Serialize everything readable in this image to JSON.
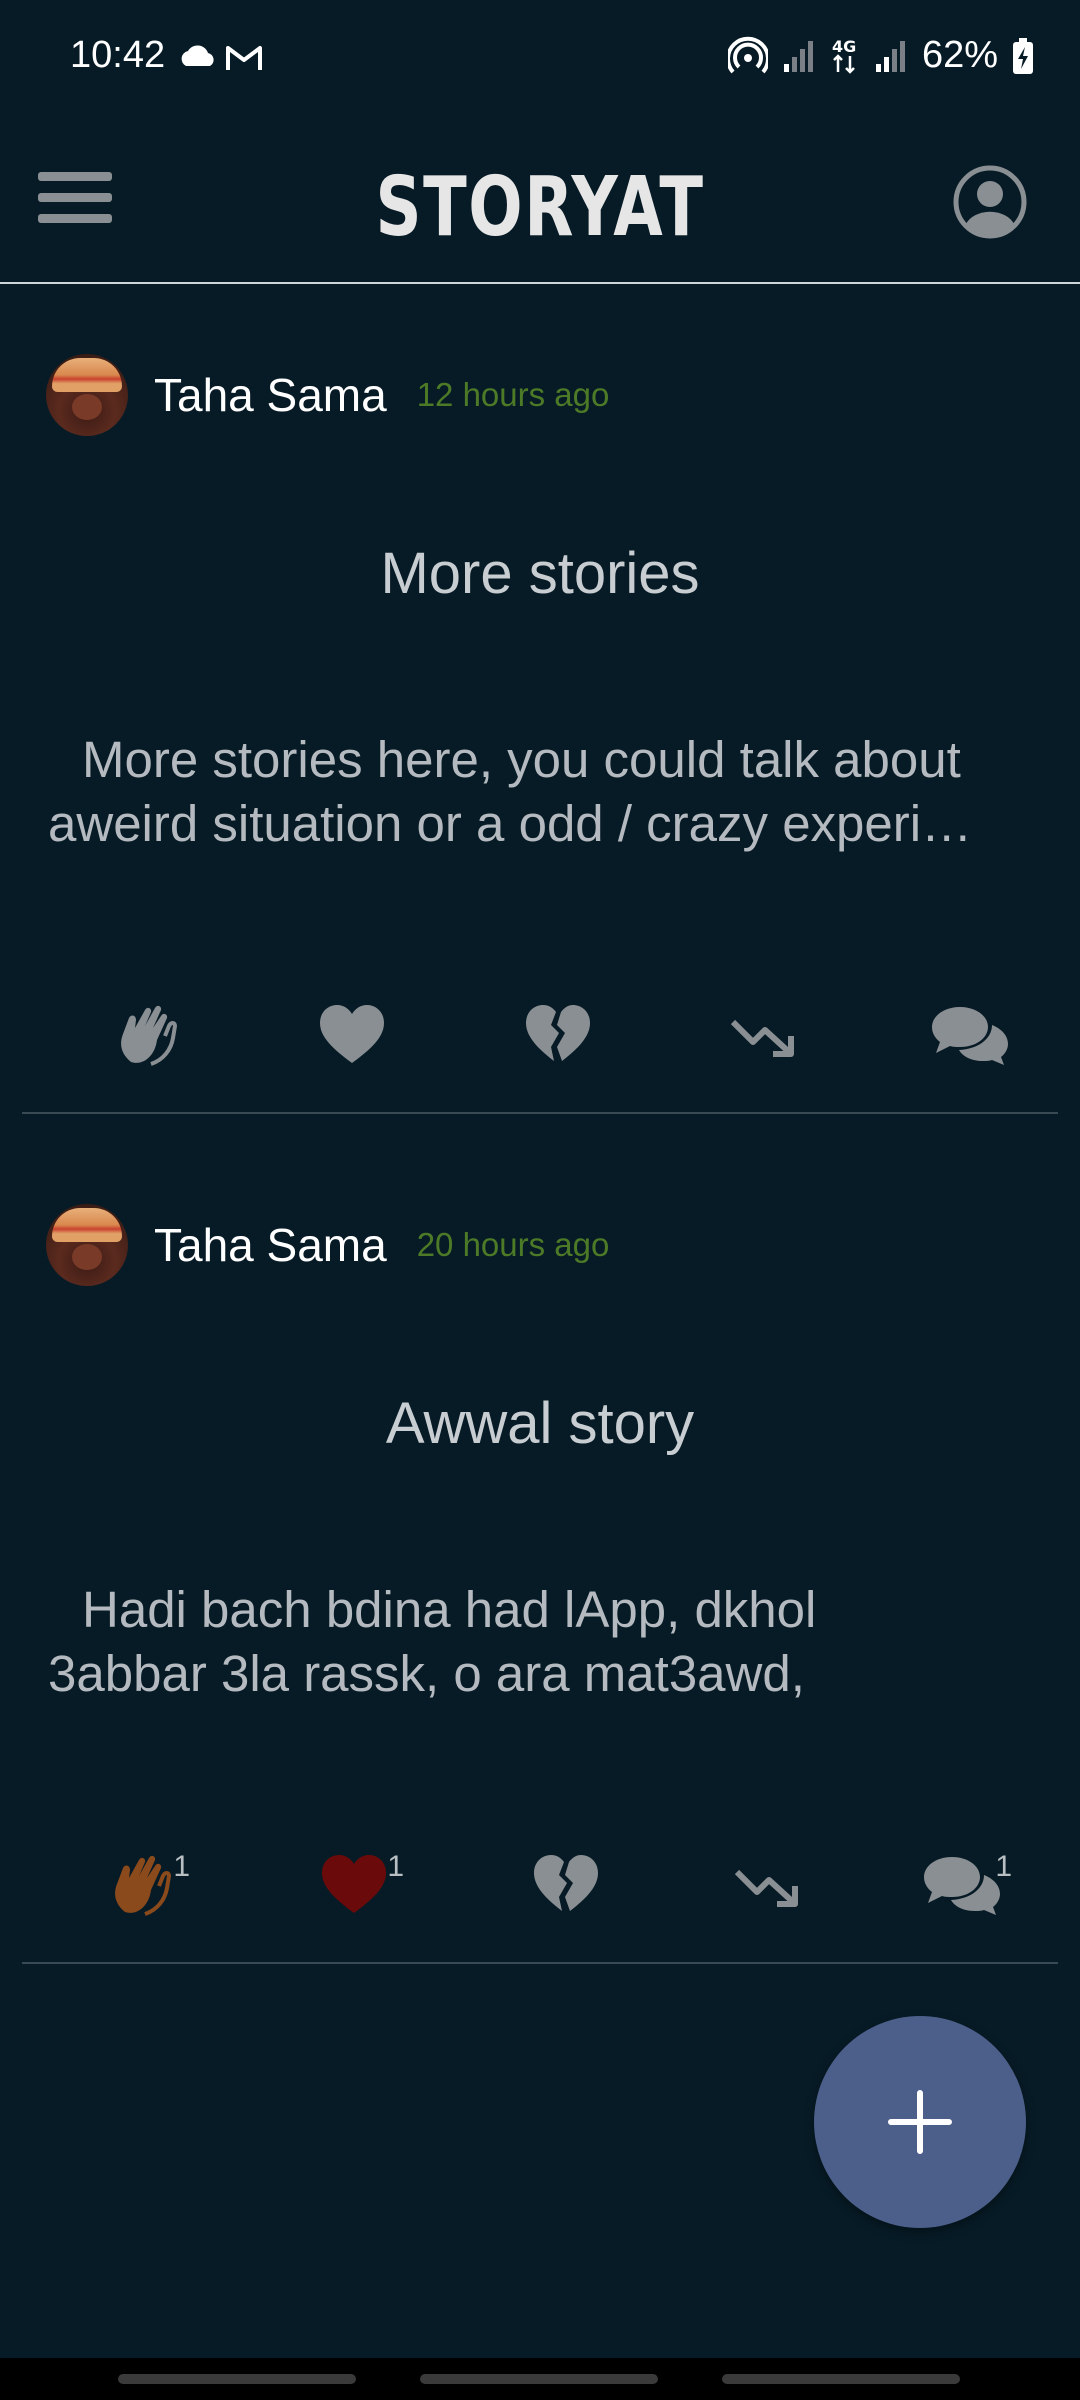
{
  "status_bar": {
    "time": "10:42",
    "left_icons": [
      "cloud-icon",
      "gmail-icon"
    ],
    "right_icons": [
      "hotspot-icon",
      "signal-weak-icon",
      "4g-data-icon",
      "signal-icon",
      "battery-charging-icon"
    ],
    "network_label": "4G",
    "battery": "62%"
  },
  "app_bar": {
    "title": "STORYAT",
    "menu_icon": "hamburger-menu-icon",
    "profile_icon": "account-circle-icon"
  },
  "posts": [
    {
      "author": "Taha Sama",
      "time": "12 hours ago",
      "title": "More stories",
      "body_line1": "More stories here, you could talk about",
      "body_line2": "aweird situation or a odd / crazy experi…",
      "reactions": [
        {
          "icon": "clap-icon",
          "count": "",
          "color": "#8a8f93"
        },
        {
          "icon": "heart-icon",
          "count": "",
          "color": "#8a8f93"
        },
        {
          "icon": "broken-heart-icon",
          "count": "",
          "color": "#8a8f93"
        },
        {
          "icon": "trending-down-icon",
          "count": "",
          "color": "#8a8f93"
        },
        {
          "icon": "comments-icon",
          "count": "",
          "color": "#8a8f93"
        }
      ]
    },
    {
      "author": "Taha Sama",
      "time": "20 hours ago",
      "title": "Awwal story",
      "body_line1": "Hadi bach bdina had lApp, dkhol",
      "body_line2": "3abbar 3la rassk, o ara mat3awd,",
      "reactions": [
        {
          "icon": "clap-icon",
          "count": "1",
          "color": "#8b4a1c"
        },
        {
          "icon": "heart-icon",
          "count": "1",
          "color": "#6b0a0a"
        },
        {
          "icon": "broken-heart-icon",
          "count": "",
          "color": "#8a8f93"
        },
        {
          "icon": "trending-down-icon",
          "count": "",
          "color": "#8a8f93"
        },
        {
          "icon": "comments-icon",
          "count": "1",
          "color": "#8a8f93"
        }
      ]
    }
  ],
  "fab": {
    "icon": "plus-icon",
    "color": "#4c5f8a"
  },
  "colors": {
    "background": "#071b26",
    "timeago": "#4d7a26",
    "divider": "#3a4a54"
  }
}
